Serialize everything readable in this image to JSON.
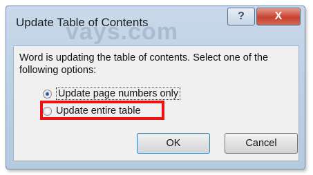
{
  "dialog": {
    "title": "Update Table of Contents",
    "watermark": "vays.com",
    "help_label": "?",
    "close_label": "X",
    "message": "Word is updating the table of contents.  Select one of the following options:",
    "options": [
      {
        "label": "Update page numbers only",
        "selected": true
      },
      {
        "label": "Update entire table",
        "selected": false
      }
    ],
    "ok_label": "OK",
    "cancel_label": "Cancel"
  },
  "colors": {
    "highlight": "#ee1111",
    "titlebar": "#c9d9ea",
    "close": "#c8412e"
  }
}
